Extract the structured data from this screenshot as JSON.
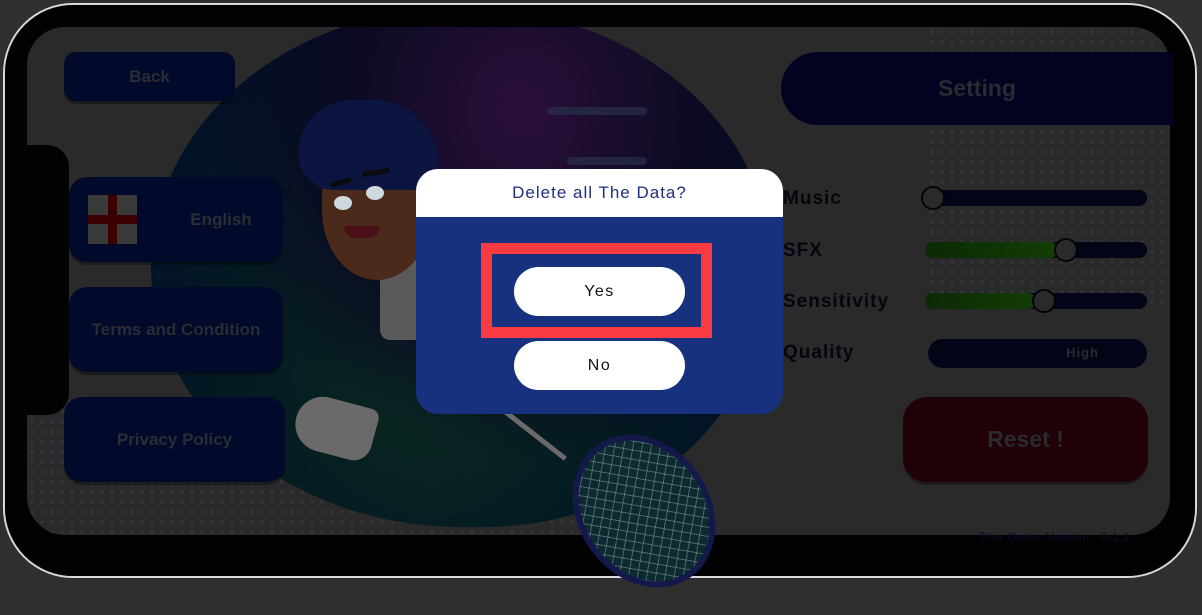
{
  "left_menu": {
    "back_label": "Back",
    "language_label": "English",
    "language_flag": "england-flag",
    "terms_label": "Terms and Condition",
    "privacy_label": "Privacy Policy"
  },
  "settings": {
    "title": "Setting",
    "rows": [
      {
        "label": "Music",
        "type": "slider",
        "value": 0.0
      },
      {
        "label": "SFX",
        "type": "slider",
        "value": 0.6
      },
      {
        "label": "Sensitivity",
        "type": "slider",
        "value": 0.5
      },
      {
        "label": "Quality",
        "type": "dropdown",
        "value": "High"
      }
    ],
    "reset_label": "Reset !",
    "version_text": "This Game Version : 0.1.1"
  },
  "dialog": {
    "title": "Delete all The Data?",
    "yes_label": "Yes",
    "no_label": "No",
    "highlight_color": "#f73b40",
    "panel_color": "#18317e"
  }
}
